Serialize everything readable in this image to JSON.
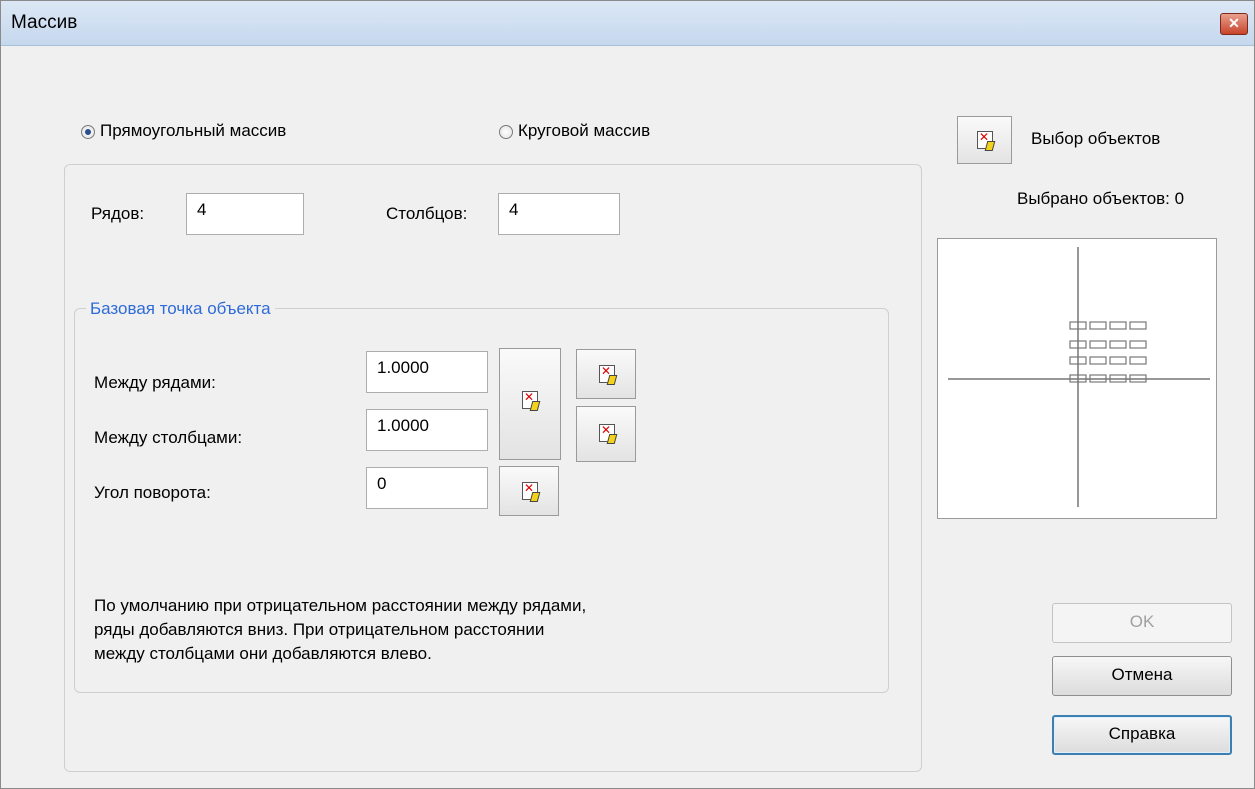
{
  "window": {
    "title": "Массив",
    "close_icon": "close-icon"
  },
  "array_type": {
    "rectangular_label": "Прямоугольный массив",
    "polar_label": "Круговой массив",
    "selected": "rectangular"
  },
  "grid": {
    "rows_label": "Рядов:",
    "rows_value": "4",
    "columns_label": "Столбцов:",
    "columns_value": "4"
  },
  "base_point": {
    "legend": "Базовая точка объекта",
    "row_offset_label": "Между рядами:",
    "row_offset_value": "1.0000",
    "column_offset_label": "Между столбцами:",
    "column_offset_value": "1.0000",
    "angle_label": "Угол поворота:",
    "angle_value": "0"
  },
  "hint": {
    "line1": "По умолчанию при отрицательном расстоянии между рядами,",
    "line2": "ряды добавляются вниз. При отрицательном расстоянии",
    "line3": "между столбцами они добавляются влево."
  },
  "selection": {
    "select_label": "Выбор объектов",
    "selected_count_label": "Выбрано объектов: 0"
  },
  "buttons": {
    "ok": "OK",
    "cancel": "Отмена",
    "help": "Справка"
  },
  "colors": {
    "legend": "#2f6bd8",
    "disabled_text": "#a0a0a0"
  }
}
